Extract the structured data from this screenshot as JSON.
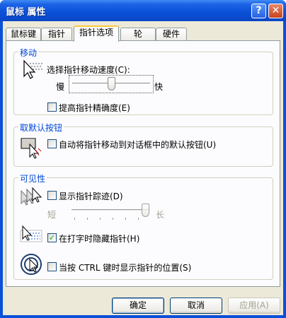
{
  "window": {
    "title": "鼠标 属性",
    "help_label": "?",
    "close_label": "✕"
  },
  "tabs": [
    {
      "label": "鼠标键",
      "active": false
    },
    {
      "label": "指针",
      "active": false
    },
    {
      "label": "指针选项",
      "active": true
    },
    {
      "label": "轮",
      "active": false
    },
    {
      "label": "硬件",
      "active": false
    }
  ],
  "motion": {
    "group_label": "移动",
    "speed_label": "选择指针移动速度(C):",
    "slow_label": "慢",
    "fast_label": "快",
    "speed_level": 0.5,
    "precision_label": "提高指针精确度(E)",
    "precision_checked": false,
    "icon": "pointer-speed-icon"
  },
  "snap_to": {
    "group_label": "取默认按钮",
    "label": "自动将指针移动到对话框中的默认按钮(U)",
    "checked": false,
    "icon": "snap-to-button-icon"
  },
  "visibility": {
    "group_label": "可见性",
    "trails_label": "显示指针踪迹(D)",
    "trails_checked": false,
    "short_label": "短",
    "long_label": "长",
    "trail_level": 1.0,
    "hide_label": "在打字时隐藏指针(H)",
    "hide_checked": true,
    "ctrl_label": "当按 CTRL 键时显示指针的位置(S)",
    "ctrl_checked": false,
    "trails_icon": "pointer-trails-icon",
    "hide_icon": "hide-pointer-icon",
    "ctrl_icon": "ctrl-locate-icon"
  },
  "buttons": {
    "ok": "确定",
    "cancel": "取消",
    "apply": "应用(A)"
  },
  "colors": {
    "titlebar": "#0a50d8",
    "group_label": "#0046d5",
    "dialog_face": "#ece9d8",
    "checkmark": "#21a121"
  }
}
